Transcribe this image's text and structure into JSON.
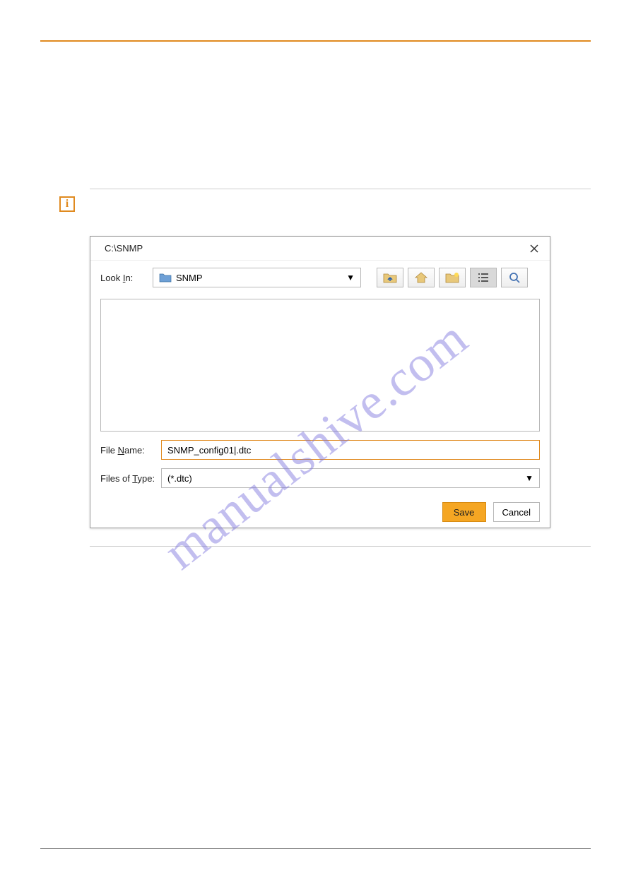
{
  "dialog": {
    "title": "C:\\SNMP",
    "look_in_label_pre": "Look ",
    "look_in_label_u": "I",
    "look_in_label_post": "n:",
    "look_in_value": "SNMP",
    "file_name_label_pre": "File ",
    "file_name_label_u": "N",
    "file_name_label_post": "ame:",
    "file_name_value": "SNMP_config01|.dtc",
    "file_type_label_pre": "Files of ",
    "file_type_label_u": "T",
    "file_type_label_post": "ype:",
    "file_type_value": "(*.dtc)",
    "save_label": "Save",
    "cancel_label": "Cancel"
  },
  "watermark": "manualshive.com",
  "icons": {
    "close": "close-icon",
    "up": "up-folder-icon",
    "home": "home-icon",
    "new_folder": "new-folder-icon",
    "list_view": "list-view-icon",
    "details_view": "details-view-icon",
    "folder": "folder-icon",
    "info": "info-icon"
  },
  "colors": {
    "accent": "#e08a1f",
    "primary_btn": "#f5a623"
  }
}
